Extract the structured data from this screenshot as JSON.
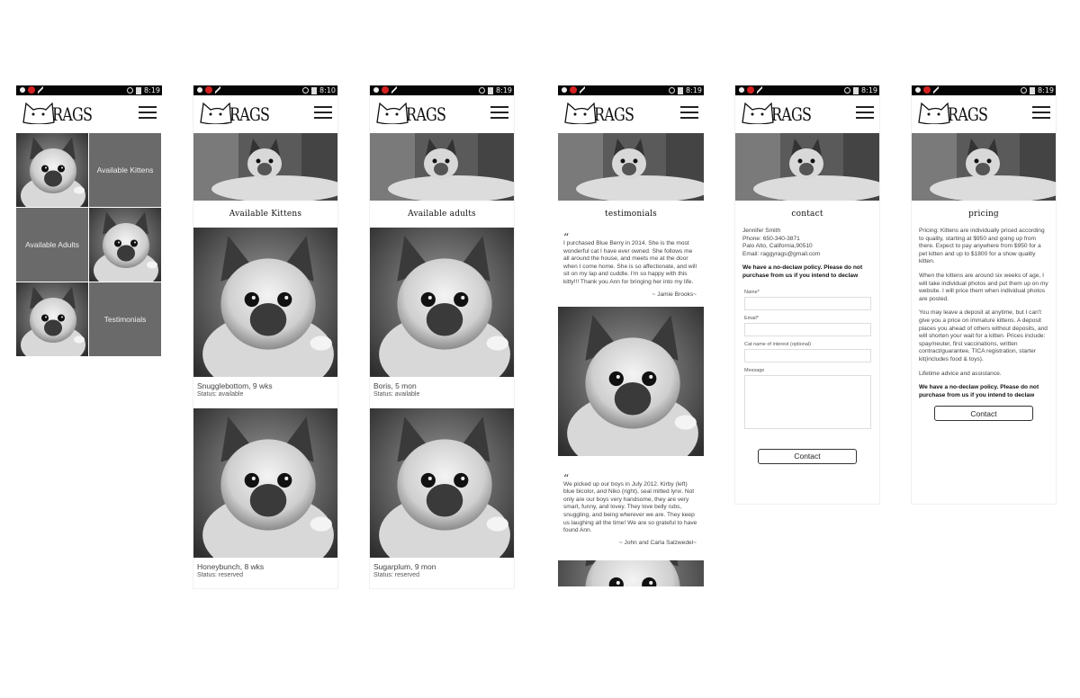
{
  "status_bar": {
    "time": "8:19",
    "time_alt": "8:10"
  },
  "brand": {
    "logo_text": "RAGS"
  },
  "home": {
    "tiles": [
      "Available Kittens",
      "Available Adults",
      "Testimonials"
    ]
  },
  "kittens": {
    "title": "Available Kittens",
    "cards": [
      {
        "name": "Snugglebottom, 9 wks",
        "status": "Status: available"
      },
      {
        "name": "Honeybunch, 8 wks",
        "status": "Status: reserved"
      }
    ]
  },
  "adults": {
    "title": "Available adults",
    "cards": [
      {
        "name": "Boris, 5 mon",
        "status": "Status: available"
      },
      {
        "name": "Sugarplum,  9 mon",
        "status": "Status: reserved"
      }
    ]
  },
  "testimonials": {
    "title": "testimonials",
    "items": [
      {
        "text": "I purchased Blue Berry in 2014.  She is the most wonderful cat I have ever owned.  She follows me all around the house, and meets me at the door when I come home.  She is so affectionate, and will sit on my lap and cuddle.  I'm so happy with this kitty!!!  Thank you Ann for bringing her into my life.",
        "author": "~ Jamie Brooks~"
      },
      {
        "text": "We picked up our boys in July 2012.  Kirby (left) blue bicolor, and Niko (right), seal mitted lynx. Not only are our boys very handsome, they are very smart, funny, and lovey. They love belly rubs, snuggling, and being wherever we are. They keep us laughing all the time! We are so grateful to have found Ann.",
        "author": "~ John and Carla Salzwedel~"
      }
    ]
  },
  "contact": {
    "title": "contact",
    "name": "Jennifer Smith",
    "phone": "Phone: 650-340-3871",
    "address": "Palo Alto, California,90510",
    "email": "Email:  raggyrags@gmail.com",
    "policy": "We have a no-declaw policy.  Please do not purchase from us if you intend to declaw",
    "labels": {
      "name": "Name*",
      "email": "Email*",
      "cat": "Cat name of interest (optional)",
      "message": "Message"
    },
    "button": "Contact"
  },
  "pricing": {
    "title": "pricing",
    "paragraphs": [
      "Pricing: Kittens are individually priced according to quality, starting at $950 and going up from there.  Expect to pay anywhere from $950 for a pet kitten and up to $1800 for a show quality kitten.",
      "When the kittens are around six weeks of age, I will take individual photos and put them up on my website. I will price them when individual photos are posted.",
      "You may leave a deposit at anytime, but I can't give you a price on immature kittens.  A deposit places you ahead of others without deposits, and will shorten  your wait for a kitten. Prices include: spay/neuter, first vaccinations, written contract/guarantee, TICA registration, starter kit(includes food & toys).",
      "Lifetime advice and assistance."
    ],
    "policy": "We have a no-declaw policy.  Please do not purchase from us if you intend to declaw",
    "button": "Contact"
  }
}
